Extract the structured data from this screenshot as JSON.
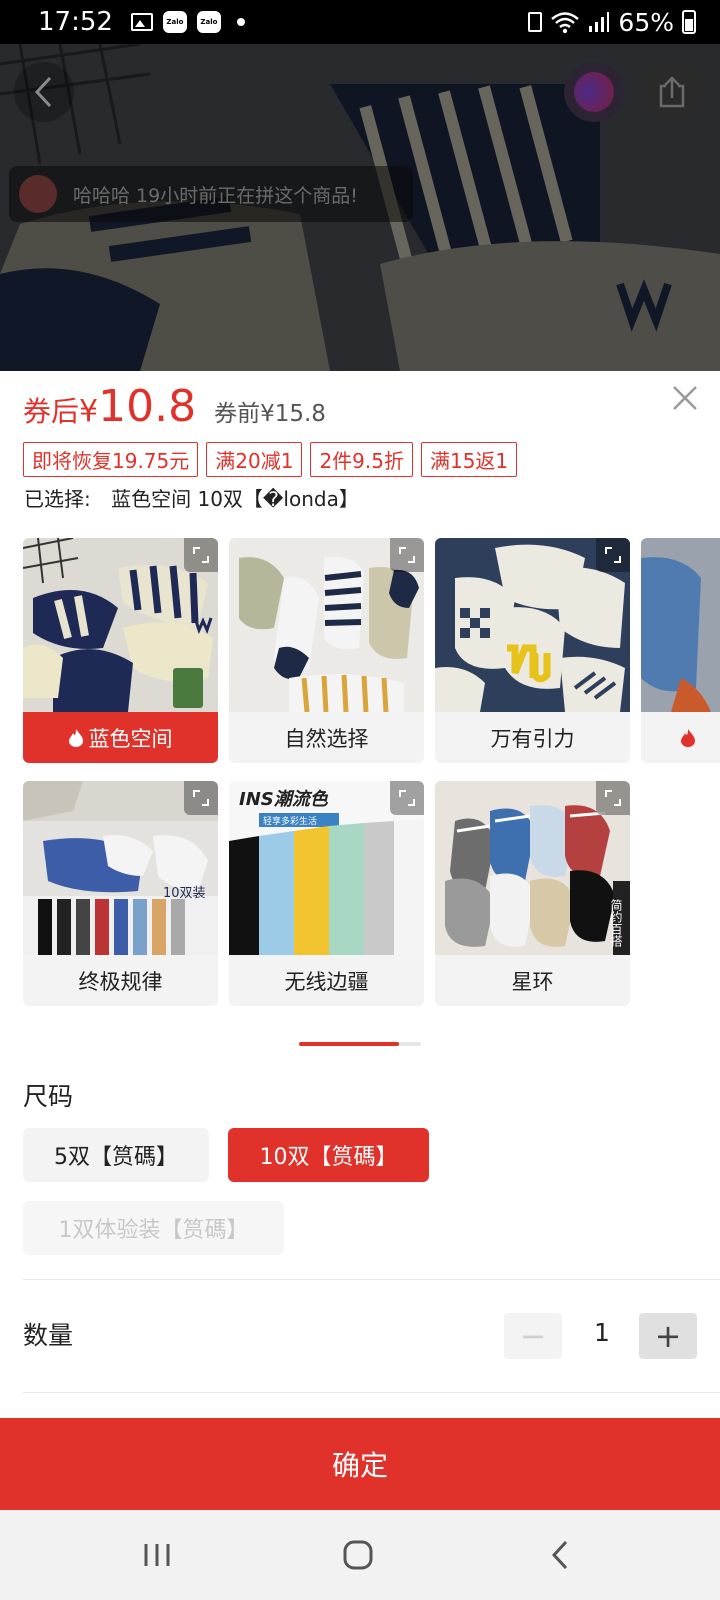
{
  "status_bar": {
    "time": "17:52",
    "notifications": [
      "gallery-icon",
      "zalo-icon",
      "zalo-icon",
      "dot-icon"
    ],
    "zalo_text": "Zalo",
    "battery": "65%"
  },
  "hero": {
    "notice": "哈哈哈 19小时前正在拼这个商品!"
  },
  "price": {
    "label": "券后",
    "currency": "¥",
    "value": "10.8",
    "original": "券前¥15.8"
  },
  "promo_tags": [
    "即将恢复19.75元",
    "满20减1",
    "2件9.5折",
    "满15返1"
  ],
  "selection": {
    "label": "已选择:",
    "value": "蓝色空间 10双【�londa】"
  },
  "variants": [
    {
      "label": "蓝色空间",
      "selected": true,
      "hot": true
    },
    {
      "label": "自然选择",
      "selected": false,
      "hot": false
    },
    {
      "label": "万有引力",
      "selected": false,
      "hot": false
    },
    {
      "label": "",
      "selected": false,
      "hot": true
    },
    {
      "label": "终极规律",
      "selected": false,
      "hot": false
    },
    {
      "label": "无线边疆",
      "selected": false,
      "hot": false
    },
    {
      "label": "星环",
      "selected": false,
      "hot": false
    }
  ],
  "variant_images": {
    "card5_badge": "10双装",
    "card6_title": "INS潮流色",
    "card6_sub": "轻享多彩生活",
    "card7_side": "简约百搭"
  },
  "size": {
    "title": "尺码",
    "options": [
      {
        "label": "5双【筼碼】",
        "state": "normal"
      },
      {
        "label": "10双【筼碼】",
        "state": "selected"
      },
      {
        "label": "1双体验装【筼碼】",
        "state": "disabled"
      }
    ]
  },
  "quantity": {
    "label": "数量",
    "value": "1",
    "minus": "−",
    "plus": "+"
  },
  "confirm_label": "确定",
  "colors": {
    "accent": "#e0322b",
    "chip_bg": "#f3f3f3"
  }
}
